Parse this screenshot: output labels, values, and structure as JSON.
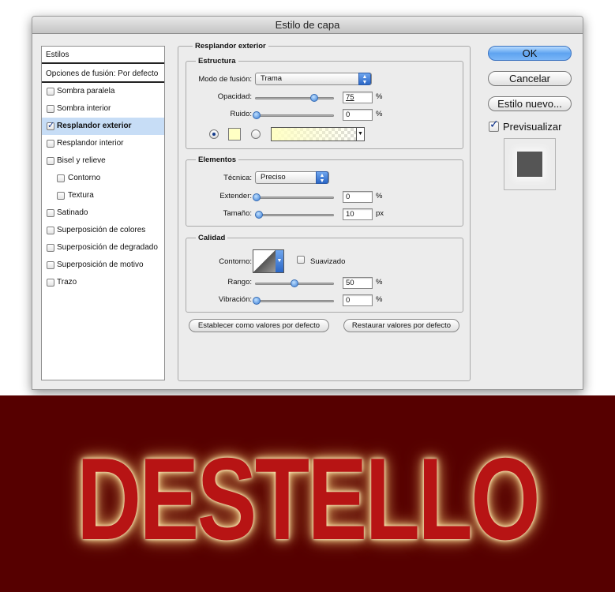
{
  "dialog": {
    "title": "Estilo de capa"
  },
  "styles_list": {
    "header": "Estilos",
    "blend_options": "Opciones de fusión: Por defecto",
    "items": [
      {
        "label": "Sombra paralela",
        "checked": false,
        "selected": false,
        "sub": false
      },
      {
        "label": "Sombra interior",
        "checked": false,
        "selected": false,
        "sub": false
      },
      {
        "label": "Resplandor exterior",
        "checked": true,
        "selected": true,
        "sub": false
      },
      {
        "label": "Resplandor interior",
        "checked": false,
        "selected": false,
        "sub": false
      },
      {
        "label": "Bisel y relieve",
        "checked": false,
        "selected": false,
        "sub": false
      },
      {
        "label": "Contorno",
        "checked": false,
        "selected": false,
        "sub": true
      },
      {
        "label": "Textura",
        "checked": false,
        "selected": false,
        "sub": true
      },
      {
        "label": "Satinado",
        "checked": false,
        "selected": false,
        "sub": false
      },
      {
        "label": "Superposición de colores",
        "checked": false,
        "selected": false,
        "sub": false
      },
      {
        "label": "Superposición de degradado",
        "checked": false,
        "selected": false,
        "sub": false
      },
      {
        "label": "Superposición de motivo",
        "checked": false,
        "selected": false,
        "sub": false
      },
      {
        "label": "Trazo",
        "checked": false,
        "selected": false,
        "sub": false
      }
    ]
  },
  "panel": {
    "title": "Resplandor exterior",
    "estructura": {
      "title": "Estructura",
      "blend_mode_label": "Modo de fusión:",
      "blend_mode_value": "Trama",
      "opacity_label": "Opacidad:",
      "opacity_value": "75",
      "opacity_unit": "%",
      "noise_label": "Ruido:",
      "noise_value": "0",
      "noise_unit": "%",
      "color_mode": "solid",
      "glow_color": "#ffffc4"
    },
    "elementos": {
      "title": "Elementos",
      "technique_label": "Técnica:",
      "technique_value": "Preciso",
      "spread_label": "Extender:",
      "spread_value": "0",
      "spread_unit": "%",
      "size_label": "Tamaño:",
      "size_value": "10",
      "size_unit": "px"
    },
    "calidad": {
      "title": "Calidad",
      "contour_label": "Contorno:",
      "antialias_label": "Suavizado",
      "antialias_checked": false,
      "range_label": "Rango:",
      "range_value": "50",
      "range_unit": "%",
      "jitter_label": "Vibración:",
      "jitter_value": "0",
      "jitter_unit": "%"
    },
    "make_default_label": "Establecer como valores por defecto",
    "reset_default_label": "Restaurar valores por defecto"
  },
  "actions": {
    "ok_label": "OK",
    "cancel_label": "Cancelar",
    "new_style_label": "Estilo nuevo...",
    "preview_label": "Previsualizar",
    "preview_checked": true
  },
  "artwork": {
    "text": "DESTELLO",
    "background_color": "#560000",
    "text_color": "#b71414",
    "glow_color": "#f6e1a2"
  }
}
